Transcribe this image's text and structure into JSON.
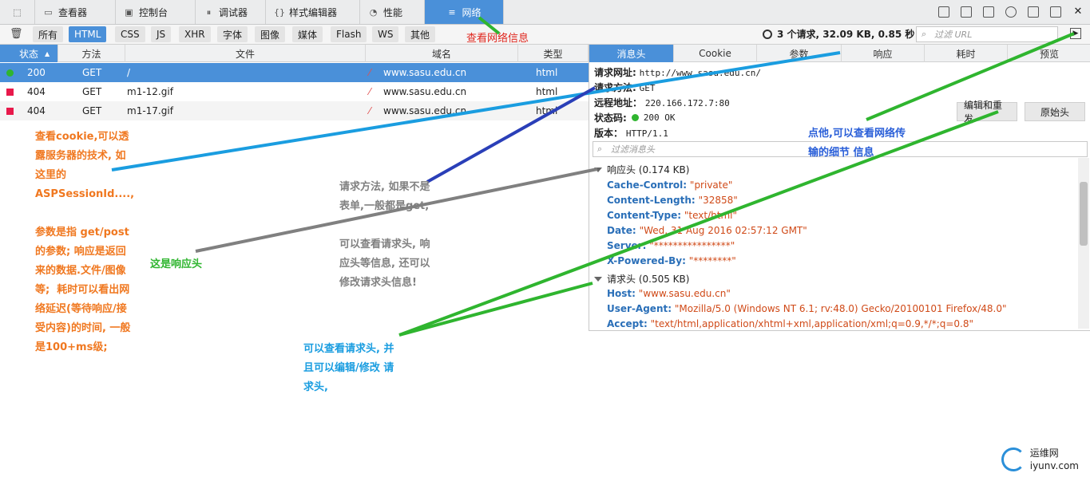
{
  "toolbar": {
    "tabs": [
      {
        "label": "查看器",
        "icon": "inspector-icon"
      },
      {
        "label": "控制台",
        "icon": "console-icon"
      },
      {
        "label": "调试器",
        "icon": "debugger-icon"
      },
      {
        "label": "样式编辑器",
        "icon": "style-editor-icon"
      },
      {
        "label": "性能",
        "icon": "performance-icon"
      },
      {
        "label": "网络",
        "icon": "network-icon",
        "active": true
      }
    ]
  },
  "filters": {
    "items": [
      "所有",
      "HTML",
      "CSS",
      "JS",
      "XHR",
      "字体",
      "图像",
      "媒体",
      "Flash",
      "WS",
      "其他"
    ],
    "active": "HTML",
    "summary": "3 个请求, 32.09 KB, 0.85 秒",
    "url_placeholder": "过滤 URL"
  },
  "table": {
    "headers": [
      "状态",
      "方法",
      "文件",
      "域名",
      "类型"
    ],
    "rows": [
      {
        "status": "200",
        "method": "GET",
        "file": "/",
        "domain": "www.sasu.edu.cn",
        "type": "html",
        "status_color": "#2fb52f"
      },
      {
        "status": "404",
        "method": "GET",
        "file": "m1-12.gif",
        "domain": "www.sasu.edu.cn",
        "type": "html",
        "status_color": "#e8194b"
      },
      {
        "status": "404",
        "method": "GET",
        "file": "m1-17.gif",
        "domain": "www.sasu.edu.cn",
        "type": "html",
        "status_color": "#e8194b"
      }
    ]
  },
  "detail": {
    "tabs": [
      "消息头",
      "Cookie",
      "参数",
      "响应",
      "耗时",
      "预览"
    ],
    "active_tab": "消息头",
    "request_url_label": "请求网址:",
    "request_url": "http://www.sasu.edu.cn/",
    "method_label": "请求方法:",
    "method": "GET",
    "remote_label": "远程地址：",
    "remote": "220.166.172.7:80",
    "status_label": "状态码:",
    "status": "200 OK",
    "version_label": "版本：",
    "version": "HTTP/1.1",
    "edit_resend": "编辑和重发",
    "raw_headers": "原始头",
    "header_filter_placeholder": "过滤消息头",
    "response_section": "响应头 (0.174 KB)",
    "response_headers": [
      {
        "name": "Cache-Control:",
        "value": "\"private\""
      },
      {
        "name": "Content-Length:",
        "value": "\"32858\""
      },
      {
        "name": "Content-Type:",
        "value": "\"text/html\""
      },
      {
        "name": "Date:",
        "value": "\"Wed, 31 Aug 2016 02:57:12 GMT\""
      },
      {
        "name": "Server:",
        "value": "\"****************\""
      },
      {
        "name": "X-Powered-By:",
        "value": "\"********\""
      }
    ],
    "request_section": "请求头 (0.505 KB)",
    "request_headers": [
      {
        "name": "Host:",
        "value": "\"www.sasu.edu.cn\""
      },
      {
        "name": "User-Agent:",
        "value": "\"Mozilla/5.0 (Windows NT 6.1; rv:48.0) Gecko/20100101 Firefox/48.0\""
      },
      {
        "name": "Accept:",
        "value": "\"text/html,application/xhtml+xml,application/xml;q=0.9,*/*;q=0.8\""
      }
    ]
  },
  "annotations": {
    "network_info": "查看网络信息",
    "cookie_note": "查看cookie,可以透\n露服务器的技术, 如\n这里的\nASPSessionId....,\n\n参数是指 get/post\n的参数; 响应是返回\n来的数据.文件/图像\n等;  耗时可以看出网\n络延迟(等待响应/接\n受内容)的时间, 一般\n是100+ms级;",
    "response_header_note": "这是响应头",
    "method_note": "请求方法, 如果不是\n表单,一般都是get,\n\n可以查看请求头, 响\n应头等信息, 还可以\n修改请求头信息!",
    "details_note": "点他,可以查看网络传\n输的细节 信息",
    "edit_note": "可以查看请求头, 并\n且可以编辑/修改 请\n求头,",
    "watermark_cn": "运维网",
    "watermark_en": "iyunv.com",
    "colors": {
      "orange": "#f07820",
      "green": "#2fb52f",
      "gray": "#808080",
      "blue": "#2a5fd8",
      "red": "#e0271e",
      "cyan": "#1a9de0"
    }
  }
}
